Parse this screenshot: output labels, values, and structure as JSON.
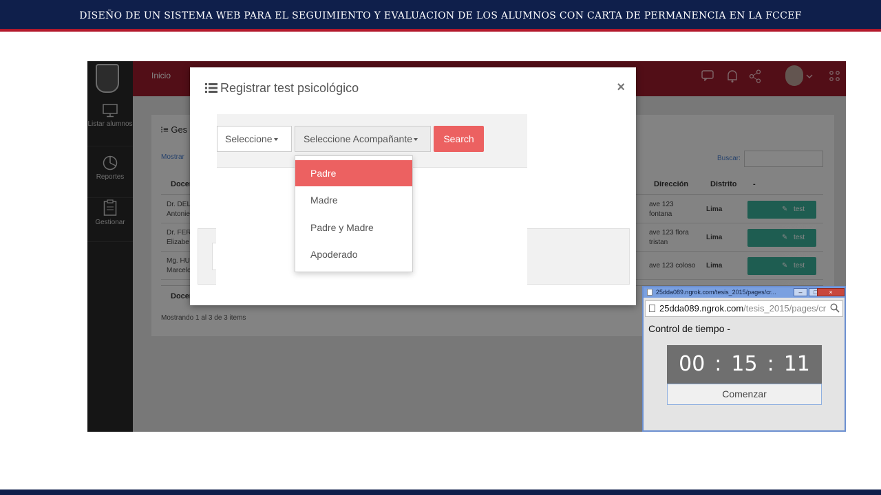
{
  "slide": {
    "header_title": "DISEÑO DE UN SISTEMA WEB PARA EL SEGUIMIENTO Y EVALUACION DE LOS ALUMNOS CON CARTA DE PERMANENCIA EN LA FCCEF"
  },
  "app": {
    "sidebar": [
      {
        "label": "Listar alumnos",
        "icon": "monitor-icon"
      },
      {
        "label": "Reportes",
        "icon": "pie-chart-icon"
      },
      {
        "label": "Gestionar",
        "icon": "clipboard-icon"
      }
    ],
    "nav": {
      "home_label": "Inicio"
    },
    "content": {
      "title": "Ges",
      "mostrar_label": "Mostrar",
      "buscar_label": "Buscar:",
      "columns": {
        "docente": "Docen",
        "direccion": "Dirección",
        "distrito": "Distrito",
        "action": "-"
      },
      "rows": [
        {
          "docente_l1": "Dr. DEL",
          "docente_l2": "Antonie",
          "direccion_l1": "ave 123",
          "direccion_l2": "fontana",
          "distrito": "Lima",
          "action": "test psicológico"
        },
        {
          "docente_l1": "Dr. FER",
          "docente_l2": "Elizabe",
          "direccion_l1": "ave 123 flora",
          "direccion_l2": "tristan",
          "distrito": "Lima",
          "action": "test psicológico"
        },
        {
          "docente_l1": "Mg. HU",
          "docente_l2": "Marcelc",
          "direccion_l1": "ave 123 coloso",
          "direccion_l2": "",
          "distrito": "Lima",
          "action": "test psicológico"
        }
      ],
      "footer_col": "Docen",
      "summary": "Mostrando 1 al 3 de 3 items"
    }
  },
  "modal": {
    "title": "Registrar test psicológico",
    "close": "×",
    "select_first": "Seleccione",
    "select_companion": "Seleccione Acompañante",
    "search_button": "Search",
    "dropdown_options": [
      "Padre",
      "Madre",
      "Padre y Madre",
      "Apoderado"
    ],
    "selected_option": "Padre",
    "accent_color": "#ec6161"
  },
  "popup": {
    "window_title": "25dda089.ngrok.com/tesis_2015/pages/cr...",
    "url_host": "25dda089.ngrok.com",
    "url_path": "/tesis_2015/pages/cr",
    "control_label": "Control de tiempo -",
    "timer": {
      "hours": "00",
      "minutes": "15",
      "seconds": "11"
    },
    "start_button": "Comenzar"
  }
}
